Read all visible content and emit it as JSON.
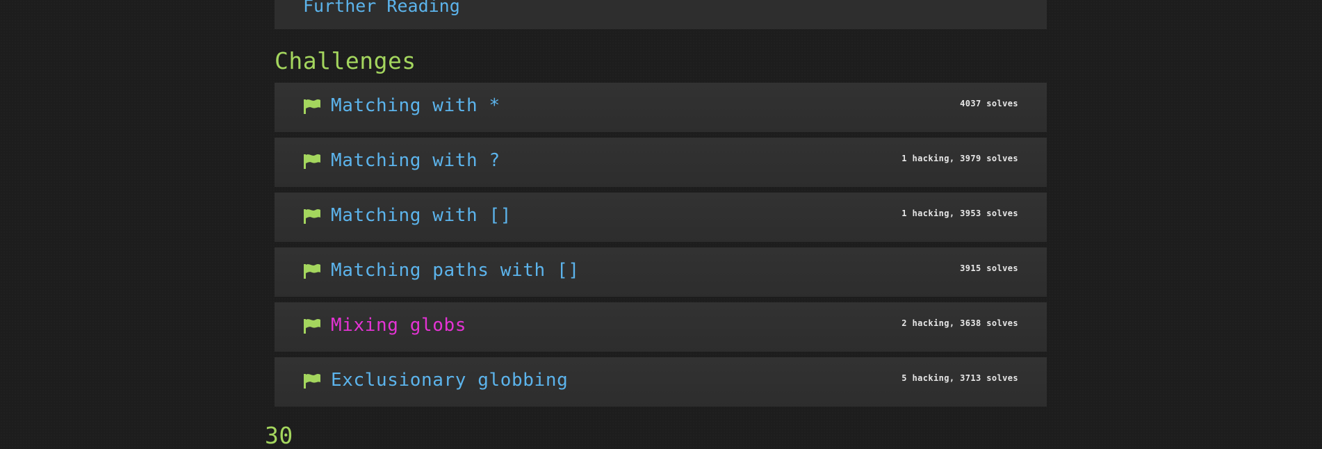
{
  "further_reading": {
    "label": "Further Reading"
  },
  "challenges_section": {
    "title": "Challenges",
    "items": [
      {
        "name": "Matching with *",
        "status": "4037 solves",
        "highlight": false
      },
      {
        "name": "Matching with ?",
        "status": "1 hacking, 3979 solves",
        "highlight": false
      },
      {
        "name": "Matching with []",
        "status": "1 hacking, 3953 solves",
        "highlight": false
      },
      {
        "name": "Matching paths with []",
        "status": "3915 solves",
        "highlight": false
      },
      {
        "name": "Mixing globs",
        "status": "2 hacking, 3638 solves",
        "highlight": true
      },
      {
        "name": "Exclusionary globbing",
        "status": "5 hacking, 3713 solves",
        "highlight": false
      }
    ]
  },
  "next_section": {
    "title": "30"
  },
  "colors": {
    "background": "#1d1d1d",
    "card": "#2e2e2e",
    "link": "#5cb4ec",
    "accent_green": "#a4d65e",
    "highlight_magenta": "#e433d4",
    "text_light": "#e8e8e8"
  },
  "icons": {
    "challenge_flag": "flag-icon"
  }
}
